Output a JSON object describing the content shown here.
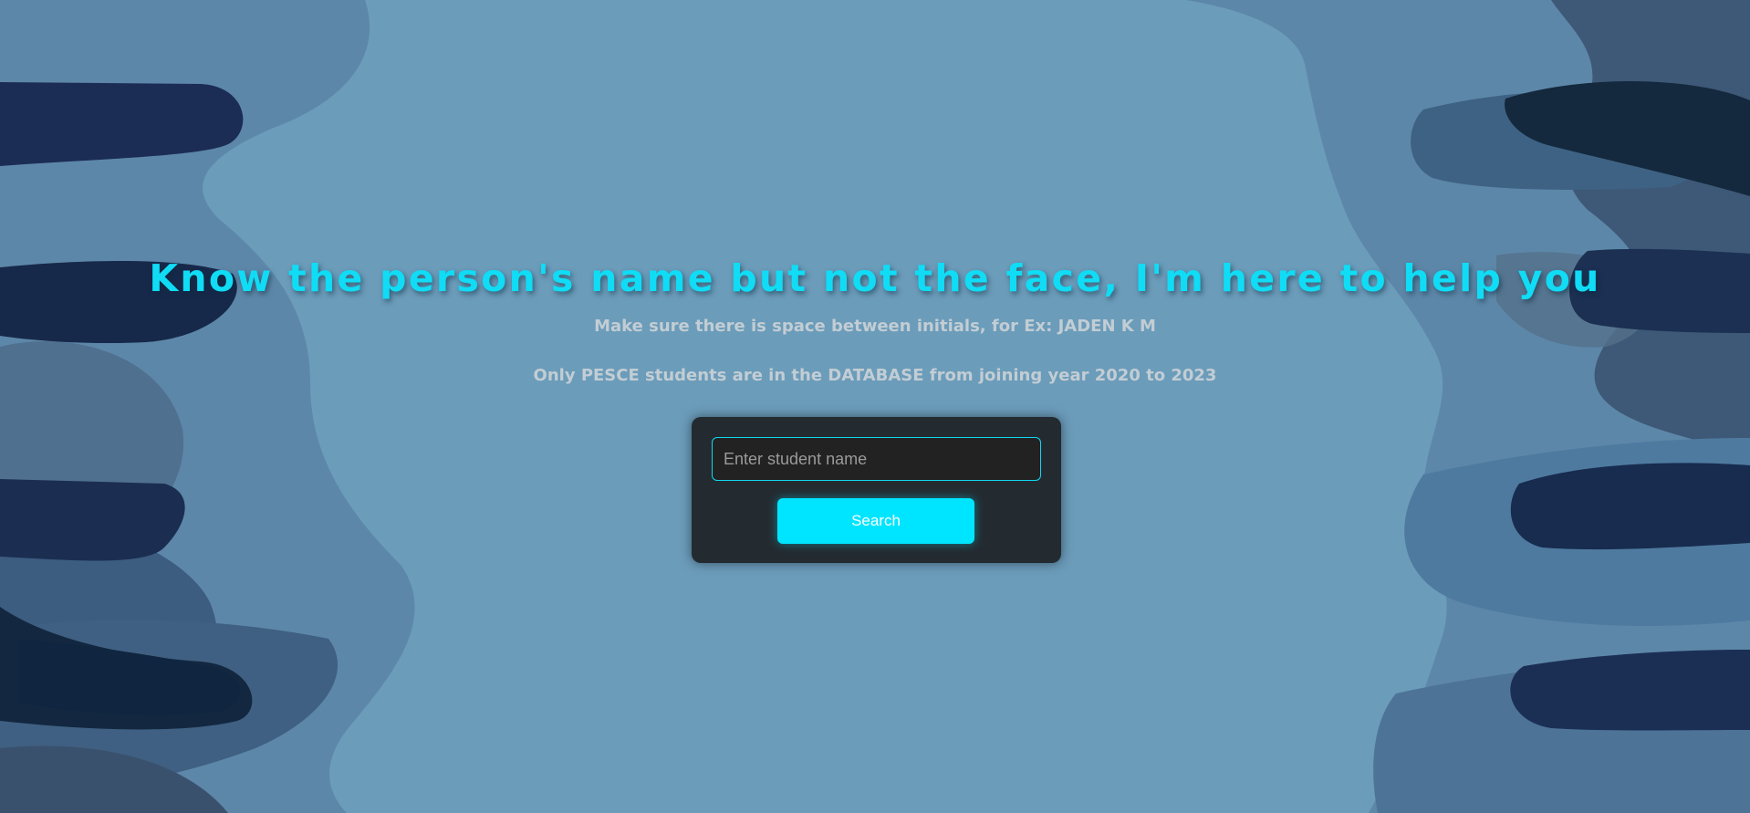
{
  "header": {
    "title": "Know the person's name but not the face, I'm here to help you",
    "hint_initials": "Make sure there is space between initials, for Ex: JADEN K M",
    "hint_database": "Only PESCE students are in the DATABASE from joining year 2020 to 2023"
  },
  "search": {
    "placeholder": "Enter student name",
    "value": "",
    "button_label": "Search"
  },
  "colors": {
    "background": "#6b9cba",
    "title": "#10dcf5",
    "accent": "#00e5ff",
    "card": "#232b31"
  }
}
